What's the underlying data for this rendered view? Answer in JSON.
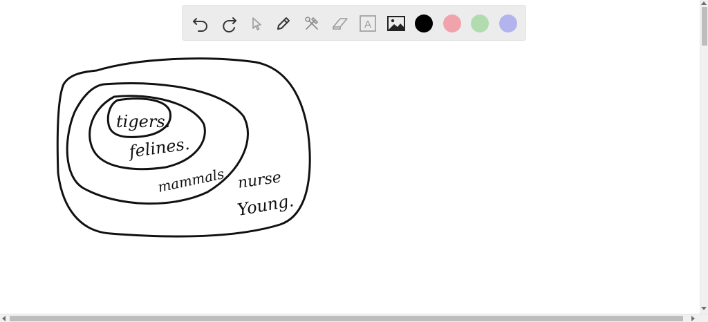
{
  "toolbar": {
    "tools": [
      {
        "name": "undo",
        "icon": "undo-icon"
      },
      {
        "name": "redo",
        "icon": "redo-icon"
      },
      {
        "name": "select",
        "icon": "cursor-icon"
      },
      {
        "name": "pen",
        "icon": "pen-icon"
      },
      {
        "name": "tools",
        "icon": "wrench-hammer-icon"
      },
      {
        "name": "eraser",
        "icon": "eraser-icon"
      },
      {
        "name": "text",
        "icon": "text-box-icon"
      },
      {
        "name": "image",
        "icon": "image-icon"
      }
    ],
    "colors": [
      "#000000",
      "#f0a3aa",
      "#b1dcb0",
      "#b3b3ee"
    ],
    "text_tool_glyph": "A"
  },
  "drawing": {
    "labels": {
      "tigers": "tigers.",
      "felines": "felines.",
      "mammals": "mammals.",
      "nurse": "nurse",
      "young": "Young."
    }
  }
}
